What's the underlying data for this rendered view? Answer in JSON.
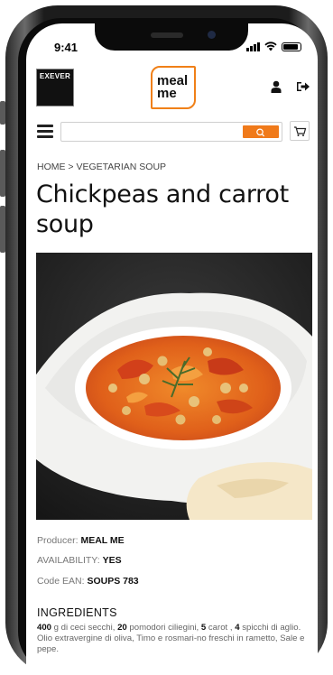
{
  "status_bar": {
    "time": "9:41"
  },
  "header": {
    "left_logo_text": "EXEVER",
    "brand_line1": "meal",
    "brand_line2": "me"
  },
  "search": {
    "placeholder": "",
    "value": ""
  },
  "breadcrumb": "HOME > VEGETARIAN SOUP",
  "product": {
    "title": "Chickpeas and carrot soup",
    "producer_label": "Producer:",
    "producer_value": "MEAL ME",
    "availability_label": "AVAILABILITY:",
    "availability_value": "YES",
    "ean_label": "Code EAN:",
    "ean_value": "SOUPS 783"
  },
  "ingredients": {
    "title": "INGREDIENTS",
    "q1": "400",
    "t1": " g di ceci secchi, ",
    "q2": "20",
    "t2": " pomodori ciliegini, ",
    "q3": "5",
    "t3": " carot , ",
    "q4": "4",
    "t4": " spicchi di aglio. Olio extravergine di oliva, Timo e rosmari-no freschi in rametto, Sale e pepe."
  },
  "colors": {
    "accent": "#f07a1a",
    "text": "#111111",
    "muted": "#777777"
  },
  "icons": [
    "user-icon",
    "logout-icon",
    "menu-icon",
    "search-icon",
    "cart-icon"
  ]
}
